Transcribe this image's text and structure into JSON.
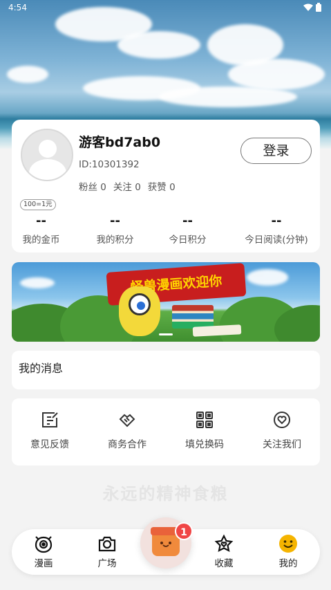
{
  "status_bar": {
    "time": "4:54"
  },
  "profile": {
    "username": "游客bd7ab0",
    "user_id": "ID:10301392",
    "social": [
      {
        "label": "粉丝",
        "value": "0"
      },
      {
        "label": "关注",
        "value": "0"
      },
      {
        "label": "获赞",
        "value": "0"
      }
    ],
    "login_label": "登录",
    "rate_badge": "100=1元",
    "stats": [
      {
        "value": "--",
        "label": "我的金币"
      },
      {
        "value": "--",
        "label": "我的积分"
      },
      {
        "value": "--",
        "label": "今日积分"
      },
      {
        "value": "--",
        "label": "今日阅读(分钟)"
      }
    ]
  },
  "banner": {
    "flag_text": "怪兽漫画欢迎你",
    "slide_count": 1
  },
  "messages": {
    "title": "我的消息"
  },
  "functions": [
    {
      "label": "意见反馈",
      "icon": "feedback-icon"
    },
    {
      "label": "商务合作",
      "icon": "handshake-icon"
    },
    {
      "label": "填兑换码",
      "icon": "qrcode-icon"
    },
    {
      "label": "关注我们",
      "icon": "heart-icon"
    }
  ],
  "slogan": "永远的精神食粮",
  "bottom_nav": {
    "items": [
      {
        "label": "漫画",
        "icon": "monster-eye-icon"
      },
      {
        "label": "广场",
        "icon": "camera-icon"
      },
      {
        "label": "收藏",
        "icon": "star-heart-icon"
      },
      {
        "label": "我的",
        "icon": "smiley-icon"
      }
    ],
    "center": {
      "icon": "gift-box-icon",
      "badge": "1"
    },
    "active_index": 3
  },
  "colors": {
    "accent": "#f04646",
    "smiley": "#f5b400",
    "banner_flag": "#c81e1e"
  }
}
